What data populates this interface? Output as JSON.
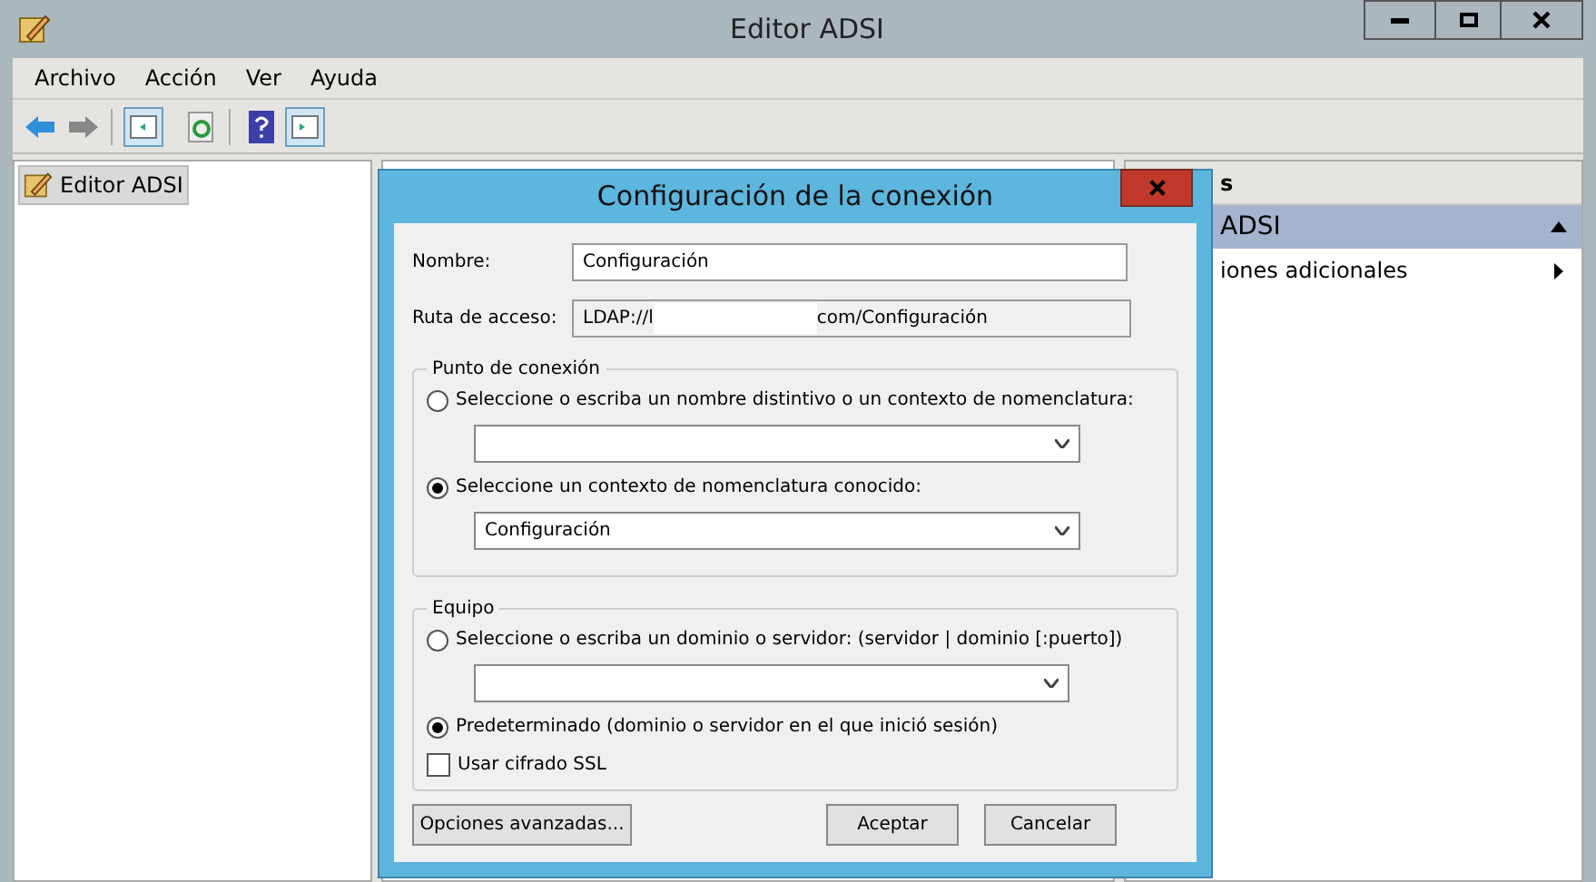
{
  "window": {
    "title": "Editor ADSI"
  },
  "menu": [
    "Archivo",
    "Acción",
    "Ver",
    "Ayuda"
  ],
  "tree": [
    {
      "label": "Editor ADSI",
      "selected": true
    }
  ],
  "actions": {
    "header": "s",
    "section": "ADSI",
    "items": [
      {
        "label": "iones adicionales"
      }
    ]
  },
  "dialog": {
    "title": "Configuración de la conexión",
    "name": {
      "label": "Nombre:",
      "value": "Configuración"
    },
    "path": {
      "label": "Ruta de acceso:",
      "value_start": "LDAP://l",
      "value_end": "com/Configuración"
    },
    "groups": [
      {
        "title": "Punto de conexión",
        "options": [
          {
            "label": "Seleccione o escriba un nombre distintivo o un contexto de nomenclatura:",
            "selected": false,
            "kind": "dropdown"
          },
          {
            "label": "Seleccione un contexto de nomenclatura conocido:",
            "selected": true,
            "kind": "dropdown",
            "combo": "Configuración"
          }
        ]
      },
      {
        "title": "Equipo",
        "options": [
          {
            "label": "Seleccione o escriba un dominio o servidor: (servidor | dominio [:puerto])",
            "selected": false,
            "kind": "dropdown"
          },
          {
            "label": "Predeterminado (dominio o servidor en el que inició sesión)",
            "selected": true,
            "kind": "plain"
          }
        ],
        "checkbox": {
          "label": "Usar cifrado SSL",
          "checked": false
        }
      }
    ],
    "buttons": [
      {
        "label": "Opciones avanzadas...",
        "kind": "left"
      },
      {
        "label": "Aceptar",
        "kind": "default"
      },
      {
        "label": "Cancelar",
        "kind": "normal"
      }
    ]
  }
}
